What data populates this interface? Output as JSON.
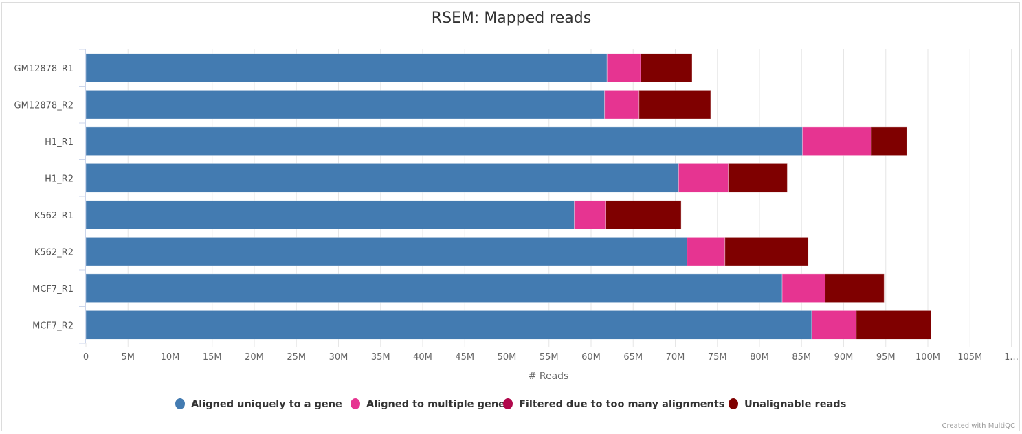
{
  "chart_data": {
    "type": "bar",
    "orientation": "horizontal",
    "stacked": true,
    "title": "RSEM: Mapped reads",
    "xlabel": "# Reads",
    "ylabel": "",
    "xlim": [
      0,
      110
    ],
    "x_unit": "M",
    "grid": true,
    "x_ticks": [
      "0",
      "5M",
      "10M",
      "15M",
      "20M",
      "25M",
      "30M",
      "35M",
      "40M",
      "45M",
      "50M",
      "55M",
      "60M",
      "65M",
      "70M",
      "75M",
      "80M",
      "85M",
      "90M",
      "95M",
      "100M",
      "105M",
      "1..."
    ],
    "categories": [
      "GM12878_R1",
      "GM12878_R2",
      "H1_R1",
      "H1_R2",
      "K562_R1",
      "K562_R2",
      "MCF7_R1",
      "MCF7_R2"
    ],
    "series": [
      {
        "name": "Aligned uniquely to a gene",
        "color": "#437bb1",
        "values": [
          61.9,
          61.6,
          85.1,
          70.4,
          58.0,
          71.4,
          82.7,
          86.2
        ]
      },
      {
        "name": "Aligned to multiple genes",
        "color": "#e63491",
        "values": [
          4.0,
          4.1,
          8.2,
          5.9,
          3.7,
          4.5,
          5.1,
          5.3
        ]
      },
      {
        "name": "Filtered due to too many alignments",
        "color": "#b1084c",
        "values": [
          0,
          0,
          0,
          0,
          0,
          0,
          0,
          0
        ]
      },
      {
        "name": "Unalignable reads",
        "color": "#7f0000",
        "values": [
          6.1,
          8.5,
          4.2,
          7.0,
          9.0,
          9.9,
          7.0,
          8.9
        ]
      }
    ],
    "legend_position": "bottom-center"
  },
  "credits": "Created with MultiQC"
}
